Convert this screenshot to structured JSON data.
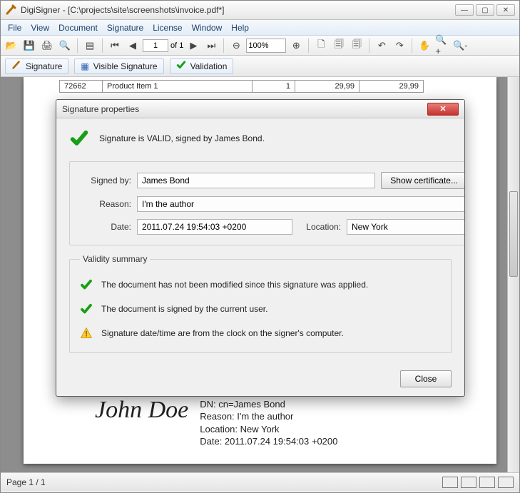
{
  "window": {
    "title": "DigiSigner - [C:\\projects\\site\\screenshots\\invoice.pdf*]"
  },
  "menu": [
    "File",
    "View",
    "Document",
    "Signature",
    "License",
    "Window",
    "Help"
  ],
  "toolbar": {
    "page_current": "1",
    "page_of_label": "of 1",
    "zoom": "100%"
  },
  "sigbar": {
    "signature": "Signature",
    "visible_signature": "Visible Signature",
    "validation": "Validation"
  },
  "table_row": {
    "id": "72662",
    "desc": "Product Item 1",
    "qty": "1",
    "price": "29,99",
    "total": "29,99"
  },
  "signature_block": {
    "name": "John Doe",
    "dn": "DN: cn=James Bond",
    "reason": "Reason: I'm the author",
    "location": "Location: New York",
    "date": "Date: 2011.07.24 19:54:03 +0200"
  },
  "status": {
    "page": "Page 1 / 1"
  },
  "dialog": {
    "title": "Signature properties",
    "valid_line": "Signature is VALID, signed by James Bond.",
    "labels": {
      "signed_by": "Signed by:",
      "reason": "Reason:",
      "date": "Date:",
      "location": "Location:",
      "show_cert": "Show certificate...",
      "validity_summary": "Validity summary",
      "close": "Close"
    },
    "values": {
      "signed_by": "James Bond",
      "reason": "I'm the author",
      "date": "2011.07.24 19:54:03 +0200",
      "location": "New York"
    },
    "summary": {
      "not_modified": "The document has not been modified since this signature was applied.",
      "current_user": "The document is signed by the current user.",
      "clock": "Signature date/time are from the clock on the signer's computer."
    }
  }
}
